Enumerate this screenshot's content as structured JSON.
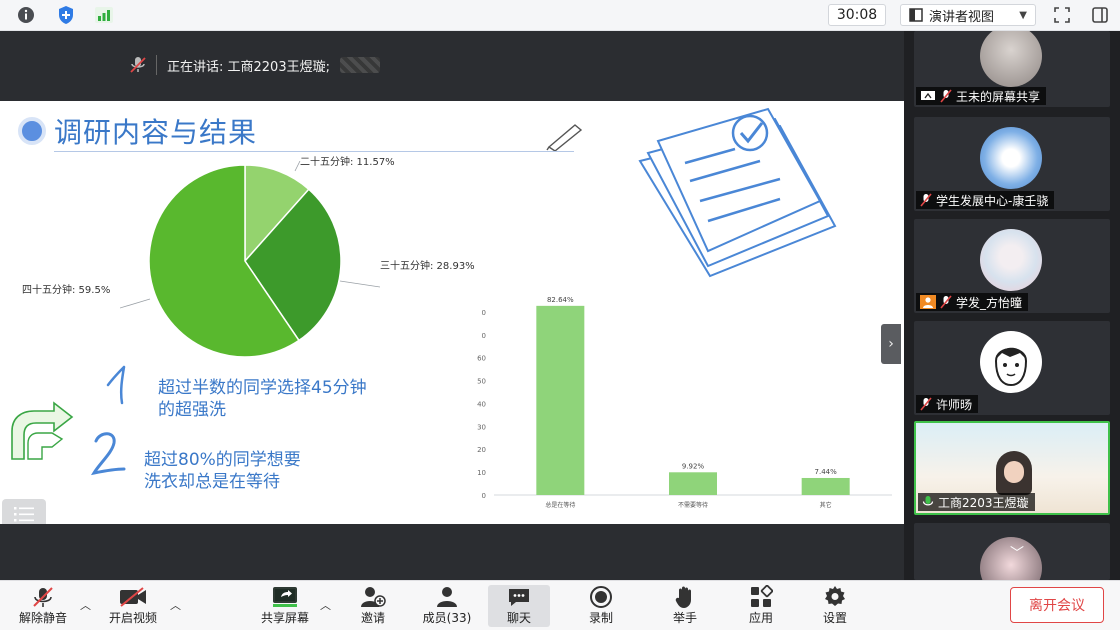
{
  "topbar": {
    "timer": "30:08",
    "view_mode": "演讲者视图",
    "icons": [
      "info-icon",
      "shield-icon",
      "signal-icon",
      "fullscreen-icon",
      "sidebar-icon"
    ]
  },
  "stage": {
    "speaking_label": "正在讲话: 工商2203王煜璇;"
  },
  "slide": {
    "title": "调研内容与结果",
    "pie": {
      "labels": [
        "二十五分钟: 11.57%",
        "三十五分钟: 28.93%",
        "四十五分钟: 59.5%"
      ]
    },
    "bullets": [
      {
        "line1": "超过半数的同学选择45分钟",
        "line2": "的超强洗"
      },
      {
        "line1": "超过80%的同学想要",
        "line2": "洗衣却总是在等待"
      }
    ]
  },
  "chart_data": [
    {
      "type": "pie",
      "categories": [
        "二十五分钟",
        "三十五分钟",
        "四十五分钟"
      ],
      "values": [
        11.57,
        28.93,
        59.5
      ],
      "labels": [
        "二十五分钟: 11.57%",
        "三十五分钟: 28.93%",
        "四十五分钟: 59.5%"
      ],
      "colors": [
        "#94d36e",
        "#3d9a2b",
        "#59b82e"
      ]
    },
    {
      "type": "bar",
      "categories": [
        "总是在等待",
        "不需要等待",
        "其它"
      ],
      "values": [
        82.64,
        9.92,
        7.44
      ],
      "data_labels": [
        "82.64%",
        "9.92%",
        "7.44%"
      ],
      "yticks": [
        "0",
        "10",
        "20",
        "30",
        "40",
        "50",
        "60",
        "0",
        "0"
      ],
      "ylim": [
        0,
        90
      ],
      "color": "#8fd47a"
    }
  ],
  "participants": [
    {
      "name": "王未的屏幕共享",
      "status_icon": "screen-share-icon",
      "mic": "mic-muted-icon"
    },
    {
      "name": "学生发展中心-康壬骁",
      "mic": "mic-muted-icon"
    },
    {
      "name": "学发_方怡曈",
      "status_icon": "person-icon",
      "mic": "mic-muted-icon"
    },
    {
      "name": "许师旸",
      "mic": "mic-muted-icon"
    },
    {
      "name": "工商2203王煜璇",
      "mic": "mic-active-icon"
    }
  ],
  "toolbar": {
    "unmute": "解除静音",
    "start_video": "开启视频",
    "share_screen": "共享屏幕",
    "invite": "邀请",
    "members": "成员(33)",
    "chat": "聊天",
    "record": "录制",
    "raise_hand": "举手",
    "apps": "应用",
    "settings": "设置",
    "leave": "离开会议"
  },
  "colors": {
    "accent_green": "#3fc14a",
    "slide_blue": "#3a78c8",
    "leave_red": "#e04646"
  }
}
